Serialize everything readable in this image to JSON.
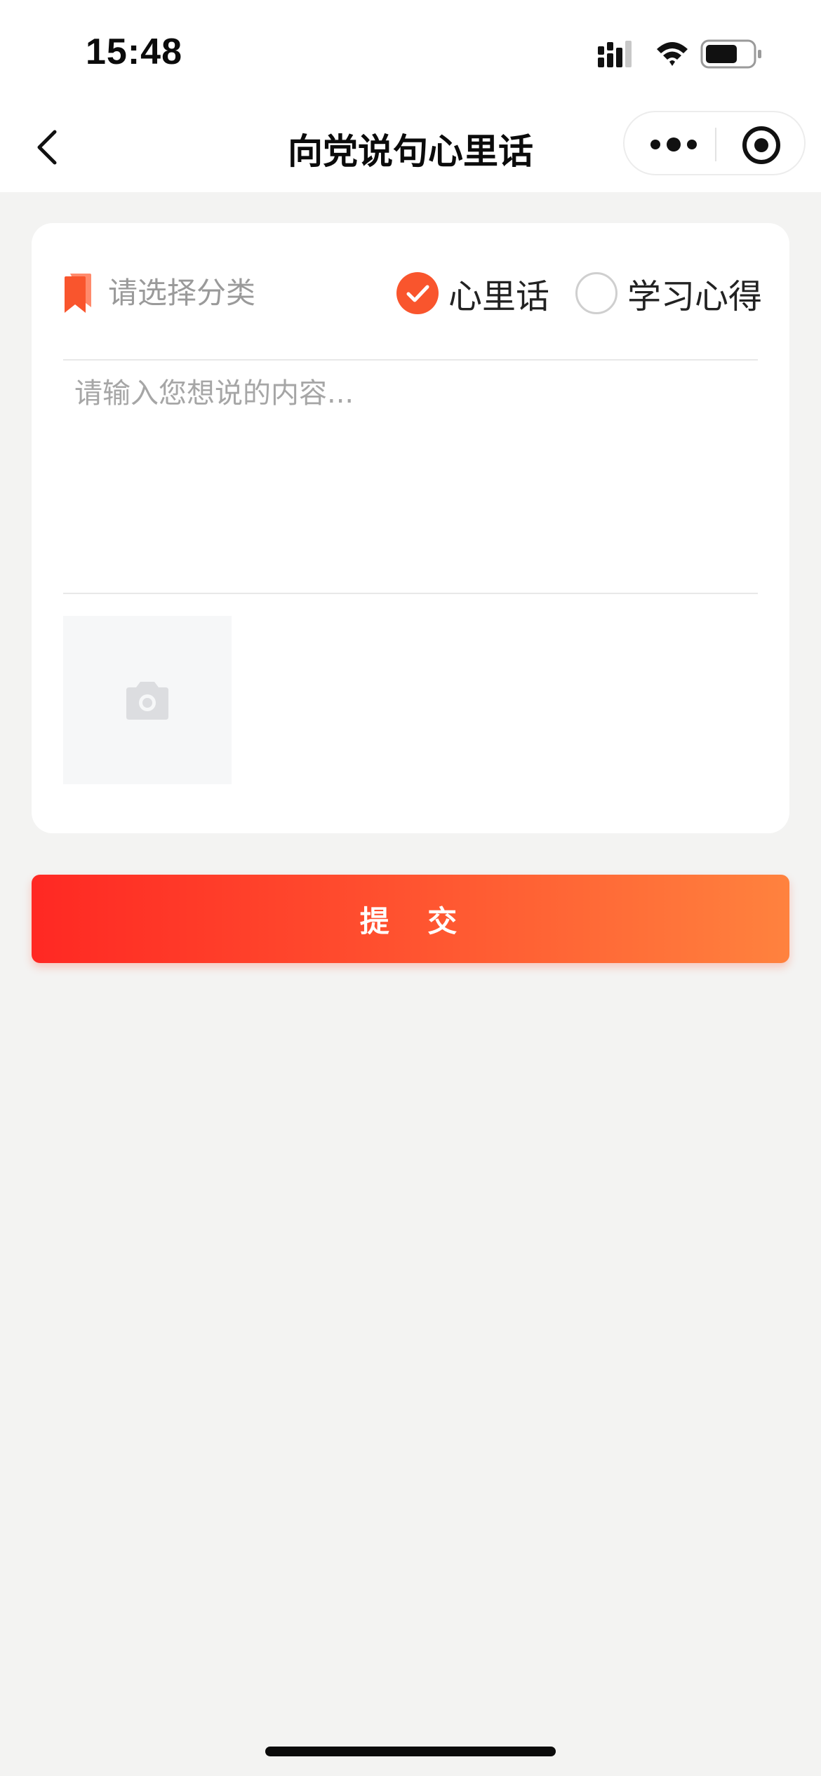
{
  "status_bar": {
    "time": "15:48"
  },
  "nav": {
    "title": "向党说句心里话"
  },
  "form": {
    "category_placeholder": "请选择分类",
    "options": [
      {
        "label": "心里话",
        "checked": true
      },
      {
        "label": "学习心得",
        "checked": false
      }
    ],
    "content_placeholder": "请输入您想说的内容..."
  },
  "submit": {
    "label": "提 交"
  },
  "colors": {
    "accent": "#f9552d",
    "gradient_start": "#ff2823",
    "gradient_end": "#ff823e",
    "background": "#f3f3f2"
  },
  "icons": {
    "back": "chevron-left-icon",
    "more": "more-dots-icon",
    "close": "target-close-icon",
    "category": "bookmark-icon",
    "upload": "camera-icon"
  }
}
